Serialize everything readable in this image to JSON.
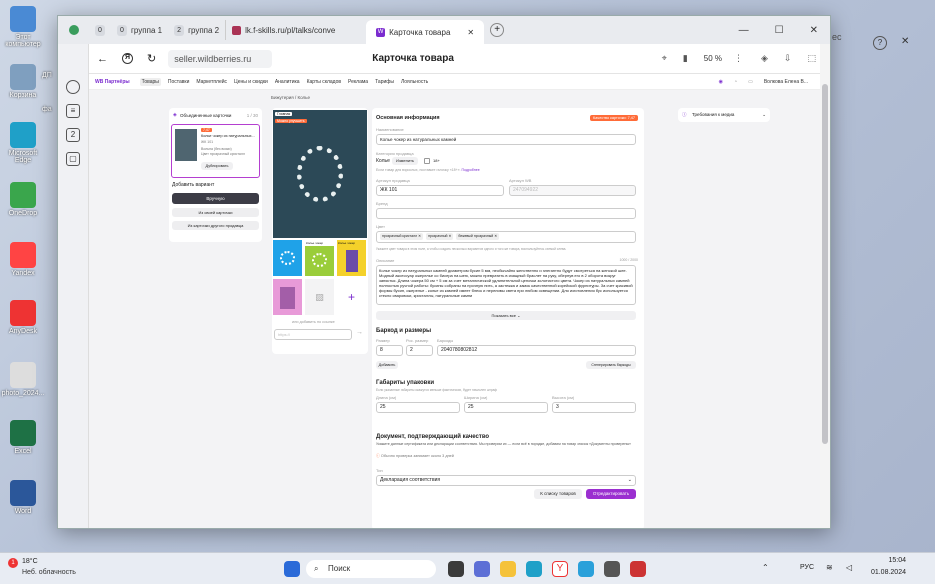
{
  "desktop": {
    "icons": [
      {
        "label": "Этот компьютер",
        "color": "#4a8ad4"
      },
      {
        "label": "Корзина",
        "color": "#7f9fbf"
      },
      {
        "label": "Microsoft Edge",
        "color": "#1fa0c8"
      },
      {
        "label": "OneDrop",
        "color": "#3aa64c"
      },
      {
        "label": "Yandex",
        "color": "#f44"
      },
      {
        "label": "AnyDesk",
        "color": "#e33"
      },
      {
        "label": "photo_2024...",
        "color": "#ddd"
      },
      {
        "label": "Excel",
        "color": "#1e7145"
      },
      {
        "label": "Word",
        "color": "#2b579a"
      }
    ],
    "mid_icons": [
      {
        "label": "ДП"
      },
      {
        "label": "фа"
      }
    ]
  },
  "browser": {
    "tabs": [
      {
        "count": "0",
        "label": ""
      },
      {
        "count": "0",
        "label": "группа 1"
      },
      {
        "count": "2",
        "label": "группа 2"
      },
      {
        "label": "lk.f-skills.ru/pl/talks/conve"
      },
      {
        "label": "Карточка товара",
        "active": true
      }
    ],
    "address": "seller.wildberries.ru",
    "page_title": "Карточка товара",
    "zoom": "50 %",
    "window_controls": [
      "—",
      "☐",
      "✕"
    ]
  },
  "wb": {
    "brand": "WB Партнёры",
    "nav": [
      "Товары",
      "Поставки",
      "Маркетплейс",
      "Цены и скидки",
      "Аналитика",
      "Карты складов",
      "Реклама",
      "Тарифы",
      "Лояльность"
    ],
    "active_nav": "Товары",
    "user": "Волкова Елена В...",
    "breadcrumb": [
      "Бижутерия",
      "Колье"
    ],
    "merged": {
      "title": "Объединенные карточки",
      "count": "1 / 30",
      "item_tag": "7,47",
      "item_title": "Колье чокер из натуральных...",
      "item_code": "ЖК 101",
      "item_size": "Вольна (без всяки)",
      "item_color": "Цвет прозрачный кристалл",
      "dup_btn": "Дублировать",
      "add_variant": "Добавить вариант",
      "manual_btn": "Вручную",
      "own_btn": "Из своей карточки",
      "other_btn": "Из карточки другого продавца"
    },
    "photo": {
      "badge1": "Главная",
      "badge2": "Можно улучшить",
      "thumb_label": "Колье чокер",
      "thumb_label2": "Колье чокер",
      "add_link": "или добавить по ссылке",
      "url_placeholder": "https://"
    },
    "info": {
      "title": "Основная информация",
      "quality": "Качество карточки: 7,47",
      "name_label": "Наименование",
      "name_value": "Колье чокер из натуральных камней",
      "category_label": "Категория продавца",
      "category": "Колье",
      "change_btn": "Изменить",
      "age_label": "18+",
      "adult_note": "Если товар для взрослых, поставьте галочку «18+».",
      "adult_link": "Подробнее",
      "article_label": "Артикул продавца",
      "article": "ЖК 101",
      "wb_article_label": "Артикул WB",
      "wb_article": "247094922",
      "brand_label": "Бренд",
      "color_label": "Цвет",
      "colors": [
        "прозрачный кристалл",
        "прозрачный",
        "бежевый прозрачный"
      ],
      "color_hint": "Укажите цвет товара в этом поле, а чтобы создать несколько вариантов одного и того же товара, воспользуйтесь схемой слева.",
      "desc_label": "Описание",
      "desc_count": "1000 / 2000",
      "description": "Колье чокер из натуральных камней диаметром бусин 5 мм, необычайно женственно и элегантно будут смотреться на женской шее. Модный аксессуар ожерелье со бисера на шею, можно превратить в изящный браслет на руку, обернув его в 2 оборота вокруг запястья. Длина чокера 50 см + 5 см за счет металлической удлинительной цепочки золотистого цвета. Чокер из натуральных камней полностью ручной работы: бусины собраны на прочную нить, а застежка и замок качественной корейской фурнитуры. За счет красивой формы бусин, ожерелье - колье из камней имеет блеск и переливы света при любом освещении. Для изготовления бус используется стекло сваровски, кристаллы, натуральные камни",
      "show_all": "Показать все"
    },
    "barcode": {
      "title": "Баркод и размеры",
      "size_label": "Размер",
      "rus_label": "Рос. размер",
      "bar_label": "Баркоды",
      "size": "8",
      "rus": "2",
      "code": "2040780802812",
      "add_btn": "Добавить",
      "gen_btn": "Сгенерировать баркоды"
    },
    "pack": {
      "title": "Габариты упаковки",
      "hint": "Если указанные габариты окажутся меньше фактических, будет начислен штраф",
      "len_label": "Длина (см)",
      "wid_label": "Ширина (см)",
      "hei_label": "Высота (см)",
      "len": "25",
      "wid": "25",
      "hei": "3"
    },
    "doc": {
      "title": "Документ, подтверждающий качество",
      "text": "Укажите данные сертификата или декларации соответствия. Мы проверим их — если всё в порядке, добавим на товар значок «Документы проверены»",
      "note": "Обычно проверка занимает около 3 дней",
      "type_label": "Тип",
      "type_value": "Декларация соответствия"
    },
    "requirements": "Требования к медиа",
    "back_btn": "К списку товаров",
    "save_btn": "Отредактировать"
  },
  "taskbar": {
    "temp": "18°C",
    "weather": "Неб. облачность",
    "search": "Поиск",
    "lang": "РУС",
    "time": "15:04",
    "date": "01.08.2024",
    "badge": "1"
  },
  "bg_text": {
    "right": "ес"
  }
}
